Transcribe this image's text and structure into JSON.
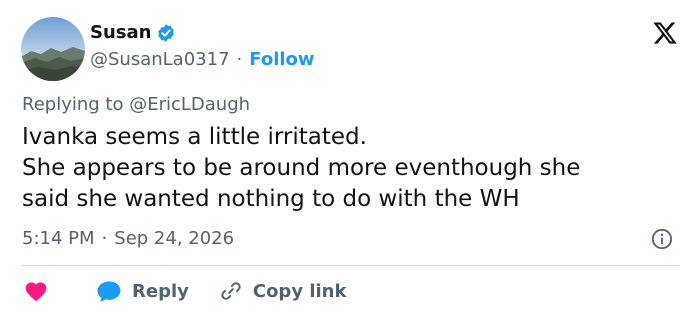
{
  "user": {
    "display_name": "Susan",
    "handle": "@SusanLa0317",
    "separator": "·",
    "follow_label": "Follow",
    "verified": true
  },
  "tweet": {
    "replying_prefix": "Replying to",
    "replying_to": "@EricLDaugh",
    "lines": [
      "Ivanka seems a little irritated.",
      "She appears to be around more eventhough she",
      "said she wanted nothing to do with the WH"
    ],
    "time": "5:14 PM",
    "date_separator": "·",
    "date": "Sep 24, 2026"
  },
  "actions": {
    "reply_label": "Reply",
    "copy_link_label": "Copy link"
  },
  "colors": {
    "accent": "#1d9bf0",
    "like": "#f91880",
    "text": "#0f1419",
    "muted": "#536471",
    "divider": "#cfd9de"
  },
  "icons": [
    "verified-badge-icon",
    "x-logo-icon",
    "heart-icon",
    "reply-bubble-icon",
    "link-icon",
    "info-icon"
  ]
}
